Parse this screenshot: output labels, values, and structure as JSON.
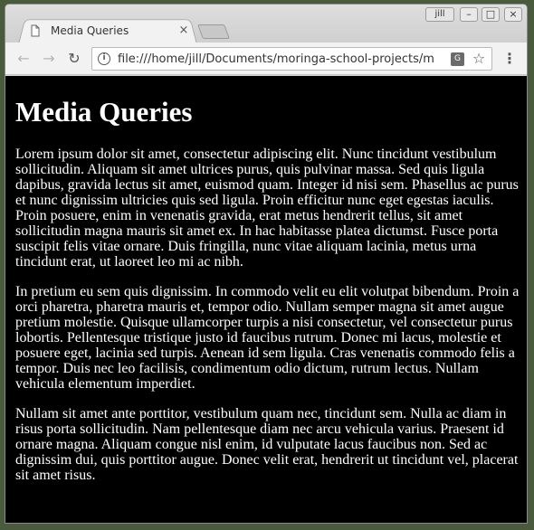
{
  "browser": {
    "tab": {
      "title": "Media Queries",
      "close_label": "×"
    },
    "profile": "jill",
    "window_controls": {
      "minimize": "–",
      "maximize": "□",
      "close": "×"
    },
    "nav": {
      "back": "←",
      "forward": "→",
      "reload": "↻"
    },
    "address_bar": {
      "url": "file:///home/jill/Documents/moringa-school-projects/m"
    },
    "menu": "⋮"
  },
  "page": {
    "heading": "Media Queries",
    "paragraphs": [
      "Lorem ipsum dolor sit amet, consectetur adipiscing elit. Nunc tincidunt vestibulum sollicitudin. Aliquam sit amet ultrices purus, quis pulvinar massa. Sed quis ligula dapibus, gravida lectus sit amet, euismod quam. Integer id nisi sem. Phasellus ac purus et nunc dignissim ultricies quis sed ligula. Proin efficitur nunc eget egestas iaculis. Proin posuere, enim in venenatis gravida, erat metus hendrerit tellus, sit amet sollicitudin magna mauris sit amet ex. In hac habitasse platea dictumst. Fusce porta suscipit felis vitae ornare. Duis fringilla, nunc vitae aliquam lacinia, metus urna tincidunt erat, ut laoreet leo mi ac nibh.",
      "In pretium eu sem quis dignissim. In commodo velit eu elit volutpat bibendum. Proin a orci pharetra, pharetra mauris et, tempor odio. Nullam semper magna sit amet augue pretium molestie. Quisque ullamcorper turpis a nisi consectetur, vel consectetur purus lobortis. Pellentesque tristique justo id faucibus rutrum. Donec mi lacus, molestie et posuere eget, lacinia sed turpis. Aenean id sem ligula. Cras venenatis commodo felis a tempor. Duis nec leo facilisis, condimentum odio dictum, rutrum lectus. Nullam vehicula elementum imperdiet.",
      "Nullam sit amet ante porttitor, vestibulum quam nec, tincidunt sem. Nulla ac diam in risus porta sollicitudin. Nam pellentesque diam nec arcu vehicula varius. Praesent id ornare magna. Aliquam congue nisl enim, id vulputate lacus faucibus non. Sed ac dignissim dui, quis porttitor augue. Donec velit erat, hendrerit ut tincidunt vel, placerat sit amet risus."
    ]
  },
  "colors": {
    "page_background": "#000000",
    "page_text": "#ffffff",
    "chrome_background": "#f2f2f2"
  }
}
